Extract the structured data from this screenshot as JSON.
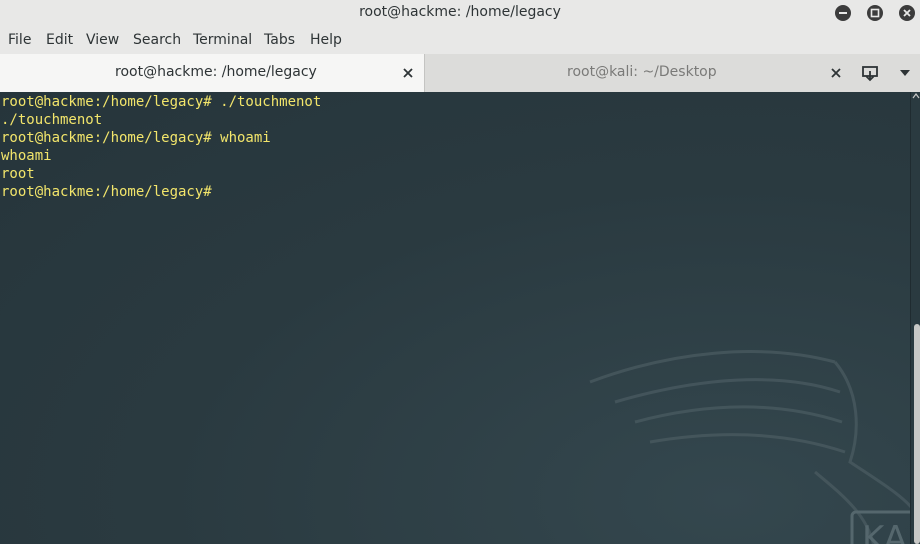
{
  "window": {
    "title": "root@hackme: /home/legacy"
  },
  "menubar": {
    "items": [
      "File",
      "Edit",
      "View",
      "Search",
      "Terminal",
      "Tabs",
      "Help"
    ]
  },
  "tabs": [
    {
      "label": "root@hackme: /home/legacy",
      "active": true
    },
    {
      "label": "root@kali: ~/Desktop",
      "active": false
    }
  ],
  "terminal": {
    "text_color": "#f2e56b",
    "lines": [
      "root@hackme:/home/legacy# ./touchmenot",
      "./touchmenot",
      "root@hackme:/home/legacy# whoami",
      "whoami",
      "root",
      "root@hackme:/home/legacy#"
    ]
  },
  "watermark": {
    "logo_text": "KA",
    "icon": "kali-dragon-icon"
  },
  "icons": {
    "minimize": "minimize-icon",
    "maximize": "maximize-icon",
    "close": "close-icon",
    "new_tab": "new-tab-icon",
    "tab_menu": "chevron-down-icon"
  }
}
